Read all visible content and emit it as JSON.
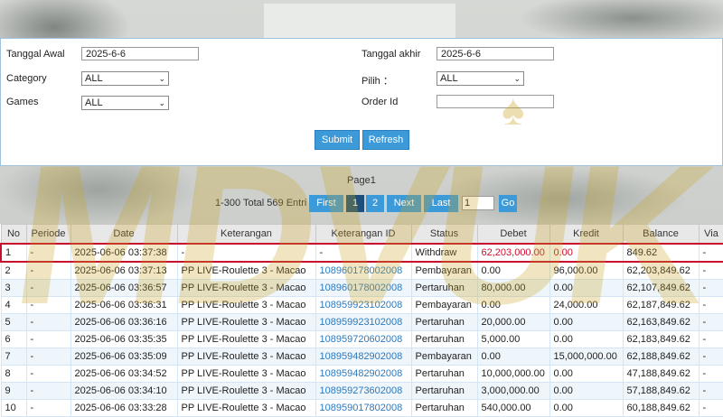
{
  "filters": {
    "tanggal_awal_label": "Tanggal Awal",
    "tanggal_awal_value": "2025-6-6",
    "tanggal_akhir_label": "Tanggal akhir",
    "tanggal_akhir_value": "2025-6-6",
    "category_label": "Category",
    "category_value": "ALL",
    "pilih_label": "Pilih ：",
    "pilih_value": "ALL",
    "games_label": "Games",
    "games_value": "ALL",
    "order_id_label": "Order Id",
    "order_id_value": "",
    "submit_label": "Submit",
    "refresh_label": "Refresh"
  },
  "pager": {
    "page_title": "Page1",
    "total_text": "1-300 Total 569 Entri",
    "first_label": "First",
    "page1_label": "1",
    "page2_label": "2",
    "next_label": "Next",
    "last_label": "Last",
    "page_input_value": "1",
    "go_label": "Go"
  },
  "table": {
    "headers": [
      "No",
      "Periode",
      "Date",
      "Keterangan",
      "Keterangan ID",
      "Status",
      "Debet",
      "Kredit",
      "Balance",
      "Via"
    ],
    "rows": [
      [
        "1",
        "-",
        "2025-06-06 03:37:38",
        "-",
        "-",
        "Withdraw",
        "62,203,000.00",
        "0.00",
        "849.62",
        "-"
      ],
      [
        "2",
        "-",
        "2025-06-06 03:37:13",
        "PP LIVE-Roulette 3 - Macao",
        "108960178002008",
        "Pembayaran",
        "0.00",
        "96,000.00",
        "62,203,849.62",
        "-"
      ],
      [
        "3",
        "-",
        "2025-06-06 03:36:57",
        "PP LIVE-Roulette 3 - Macao",
        "108960178002008",
        "Pertaruhan",
        "80,000.00",
        "0.00",
        "62,107,849.62",
        "-"
      ],
      [
        "4",
        "-",
        "2025-06-06 03:36:31",
        "PP LIVE-Roulette 3 - Macao",
        "108959923102008",
        "Pembayaran",
        "0.00",
        "24,000.00",
        "62,187,849.62",
        "-"
      ],
      [
        "5",
        "-",
        "2025-06-06 03:36:16",
        "PP LIVE-Roulette 3 - Macao",
        "108959923102008",
        "Pertaruhan",
        "20,000.00",
        "0.00",
        "62,163,849.62",
        "-"
      ],
      [
        "6",
        "-",
        "2025-06-06 03:35:35",
        "PP LIVE-Roulette 3 - Macao",
        "108959720602008",
        "Pertaruhan",
        "5,000.00",
        "0.00",
        "62,183,849.62",
        "-"
      ],
      [
        "7",
        "-",
        "2025-06-06 03:35:09",
        "PP LIVE-Roulette 3 - Macao",
        "108959482902008",
        "Pembayaran",
        "0.00",
        "15,000,000.00",
        "62,188,849.62",
        "-"
      ],
      [
        "8",
        "-",
        "2025-06-06 03:34:52",
        "PP LIVE-Roulette 3 - Macao",
        "108959482902008",
        "Pertaruhan",
        "10,000,000.00",
        "0.00",
        "47,188,849.62",
        "-"
      ],
      [
        "9",
        "-",
        "2025-06-06 03:34:10",
        "PP LIVE-Roulette 3 - Macao",
        "108959273602008",
        "Pertaruhan",
        "3,000,000.00",
        "0.00",
        "57,188,849.62",
        "-"
      ],
      [
        "10",
        "-",
        "2025-06-06 03:33:28",
        "PP LIVE-Roulette 3 - Macao",
        "108959017802008",
        "Pertaruhan",
        "540,000.00",
        "0.00",
        "60,188,849.62",
        "-"
      ]
    ]
  },
  "watermark": {
    "text": "MDVUK",
    "symbol": "♠",
    "color": "#c8a01e"
  },
  "colors": {
    "accent": "#3c9ad8",
    "active_page": "#1d4f7a",
    "highlight_red": "#c8102e",
    "link_blue": "#2a7ac0"
  }
}
